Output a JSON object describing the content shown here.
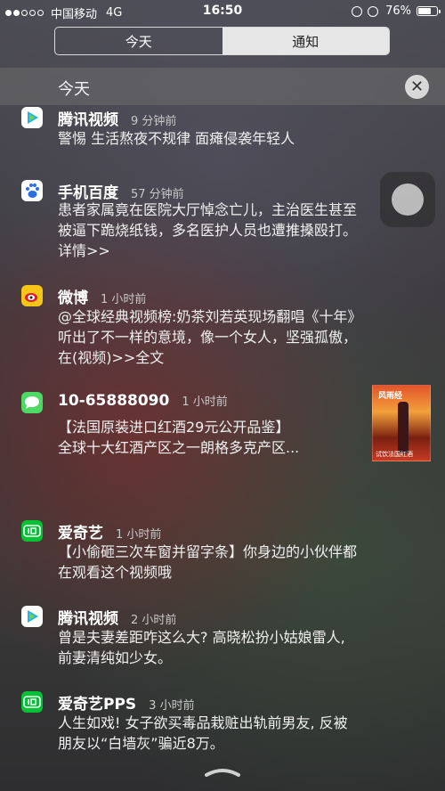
{
  "status_bar": {
    "carrier": "中国移动",
    "network": "4G",
    "time": "16:50",
    "battery_pct": "76%",
    "battery_level": 0.76,
    "icons": [
      "signal-dots",
      "lock-rotation-icon",
      "alarm-icon",
      "battery-icon"
    ]
  },
  "tabs": [
    {
      "label": "今天",
      "active": false
    },
    {
      "label": "通知",
      "active": true
    }
  ],
  "section": {
    "title": "今天",
    "close_symbol": "✕"
  },
  "notifications": [
    {
      "app": "腾讯视频",
      "time": "9 分钟前",
      "body": "警惕 生活熬夜不规律 面瘫侵袭年轻人",
      "icon": "tencent-video-icon"
    },
    {
      "app": "手机百度",
      "time": "57 分钟前",
      "body": "患者家属竟在医院大厅悼念亡儿，主治医生甚至\n被逼下跪烧纸钱，多名医护人员也遭推搡殴打。\n详情>>",
      "icon": "baidu-icon"
    },
    {
      "app": "微博",
      "time": "1 小时前",
      "body": "@全球经典视频榜:奶茶刘若英现场翻唱《十年》\n听出了不一样的意境，像一个女人，坚强孤傲，\n在(视频)>>全文",
      "icon": "weibo-icon"
    },
    {
      "app": "10-65888090",
      "time": "1 小时前",
      "body": "【法国原装进口红酒29元公开品鉴】\n全球十大红酒产区之一朗格多克产区...",
      "icon": "messages-icon",
      "thumb_title": "风雨经",
      "thumb_caption": "试饮法国红酒"
    },
    {
      "app": "爱奇艺",
      "time": "1 小时前",
      "body": "【小偷砸三次车窗并留字条】你身边的小伙伴都\n在观看这个视频哦",
      "icon": "iqiyi-icon"
    },
    {
      "app": "腾讯视频",
      "time": "2 小时前",
      "body": "曾是夫妻差距咋这么大? 高晓松扮小姑娘雷人,\n前妻清纯如少女。",
      "icon": "tencent-video-icon"
    },
    {
      "app": "爱奇艺PPS",
      "time": "3 小时前",
      "body": "人生如戏! 女子欲买毒品栽赃出轨前男友, 反被\n朋友以“白墙灰”骗近8万。",
      "icon": "iqiyi-pps-icon"
    }
  ],
  "colors": {
    "tencent": "#1fb2f0",
    "baidu": "#2c6fe0",
    "weibo": "#f5c518",
    "messages": "#4cd964",
    "iqiyi": "#00c234"
  }
}
